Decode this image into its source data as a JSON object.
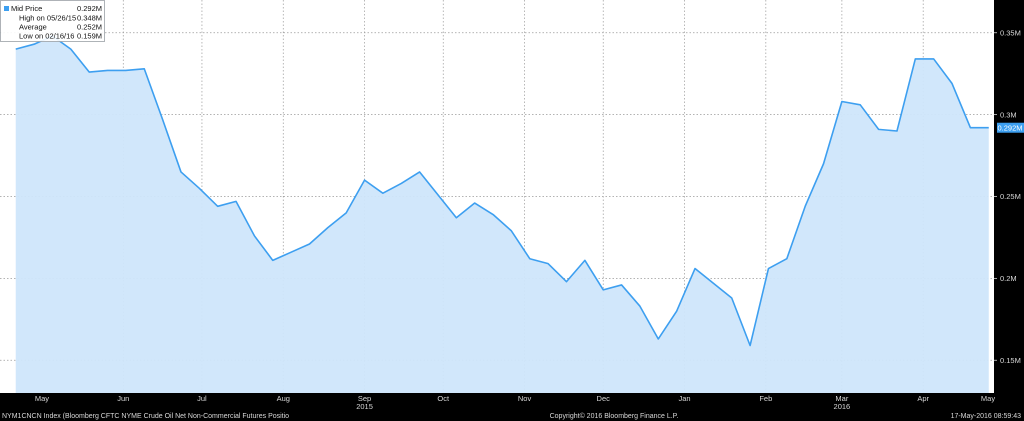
{
  "chart_data": {
    "type": "area",
    "ticker": "NYM1CNCN Index (Bloomberg CFTC NYME Crude Oil Net Non-Commercial Futures Positio",
    "copyright": "Copyright© 2016 Bloomberg Finance L.P.",
    "timestamp": "17-May-2016 08:59:43",
    "series": [
      {
        "name": "Mid Price",
        "color": "#3d9ff0",
        "fill": "#cfe6fb",
        "x": [
          "2015-05-05",
          "2015-05-12",
          "2015-05-19",
          "2015-05-26",
          "2015-06-02",
          "2015-06-09",
          "2015-06-16",
          "2015-06-23",
          "2015-06-30",
          "2015-07-07",
          "2015-07-14",
          "2015-07-21",
          "2015-07-28",
          "2015-08-04",
          "2015-08-11",
          "2015-08-18",
          "2015-08-25",
          "2015-09-01",
          "2015-09-08",
          "2015-09-15",
          "2015-09-22",
          "2015-09-29",
          "2015-10-06",
          "2015-10-13",
          "2015-10-20",
          "2015-10-27",
          "2015-11-03",
          "2015-11-10",
          "2015-11-17",
          "2015-11-24",
          "2015-12-01",
          "2015-12-08",
          "2015-12-15",
          "2015-12-22",
          "2015-12-29",
          "2016-01-05",
          "2016-01-12",
          "2016-01-19",
          "2016-01-26",
          "2016-02-02",
          "2016-02-09",
          "2016-02-16",
          "2016-02-23",
          "2016-03-01",
          "2016-03-08",
          "2016-03-15",
          "2016-03-22",
          "2016-03-29",
          "2016-04-05",
          "2016-04-12",
          "2016-04-19",
          "2016-04-26",
          "2016-05-03",
          "2016-05-10"
        ],
        "values": [
          0.34,
          0.343,
          0.348,
          0.34,
          0.326,
          0.327,
          0.327,
          0.328,
          0.297,
          0.265,
          0.255,
          0.244,
          0.247,
          0.226,
          0.211,
          0.216,
          0.221,
          0.231,
          0.24,
          0.26,
          0.252,
          0.258,
          0.265,
          0.251,
          0.237,
          0.246,
          0.239,
          0.229,
          0.212,
          0.209,
          0.198,
          0.211,
          0.193,
          0.196,
          0.183,
          0.163,
          0.18,
          0.206,
          0.197,
          0.188,
          0.159,
          0.206,
          0.212,
          0.244,
          0.27,
          0.308,
          0.306,
          0.291,
          0.29,
          0.334,
          0.334,
          0.319,
          0.292,
          0.292
        ]
      }
    ],
    "legend": {
      "rows": [
        {
          "label": "Mid Price",
          "value": "0.292M"
        },
        {
          "label": "High on 05/26/15",
          "value": "0.348M"
        },
        {
          "label": "Average",
          "value": "0.252M"
        },
        {
          "label": "Low on 02/16/16",
          "value": "0.159M"
        }
      ],
      "placement": "top-left"
    },
    "last_value_label": "0.292M",
    "y_axis": {
      "ticks": [
        0.15,
        0.2,
        0.25,
        0.3,
        0.35
      ],
      "tick_labels": [
        "0.15M",
        "0.2M",
        "0.25M",
        "0.3M",
        "0.35M"
      ],
      "ylim": [
        0.13,
        0.37
      ],
      "position": "right"
    },
    "x_axis": {
      "month_labels": [
        "May",
        "Jun",
        "Jul",
        "Aug",
        "Sep",
        "Oct",
        "Nov",
        "Dec",
        "Jan",
        "Feb",
        "Mar",
        "Apr",
        "May"
      ],
      "month_positions": [
        "2015-05-01",
        "2015-06-01",
        "2015-07-01",
        "2015-08-01",
        "2015-09-01",
        "2015-10-01",
        "2015-11-01",
        "2015-12-01",
        "2016-01-01",
        "2016-02-01",
        "2016-03-01",
        "2016-04-01",
        "2016-05-01"
      ],
      "gridlines": [
        "2015-06-15",
        "2015-07-15",
        "2015-08-15",
        "2015-09-15",
        "2015-10-15",
        "2015-11-15",
        "2015-12-15",
        "2016-01-15",
        "2016-02-15",
        "2016-03-15",
        "2016-04-15"
      ],
      "year_labels": [
        "2015",
        "2016"
      ],
      "year_label_positions": [
        "2015-09-01",
        "2016-03-01"
      ],
      "xlim": [
        "2015-04-29",
        "2016-05-12"
      ]
    },
    "grid": true,
    "colors": {
      "background": "#ffffff",
      "frame": "#000000",
      "line": "#3d9ff0",
      "area": "#cfe6fb",
      "legend_swatch": "#3d9ff0"
    }
  }
}
